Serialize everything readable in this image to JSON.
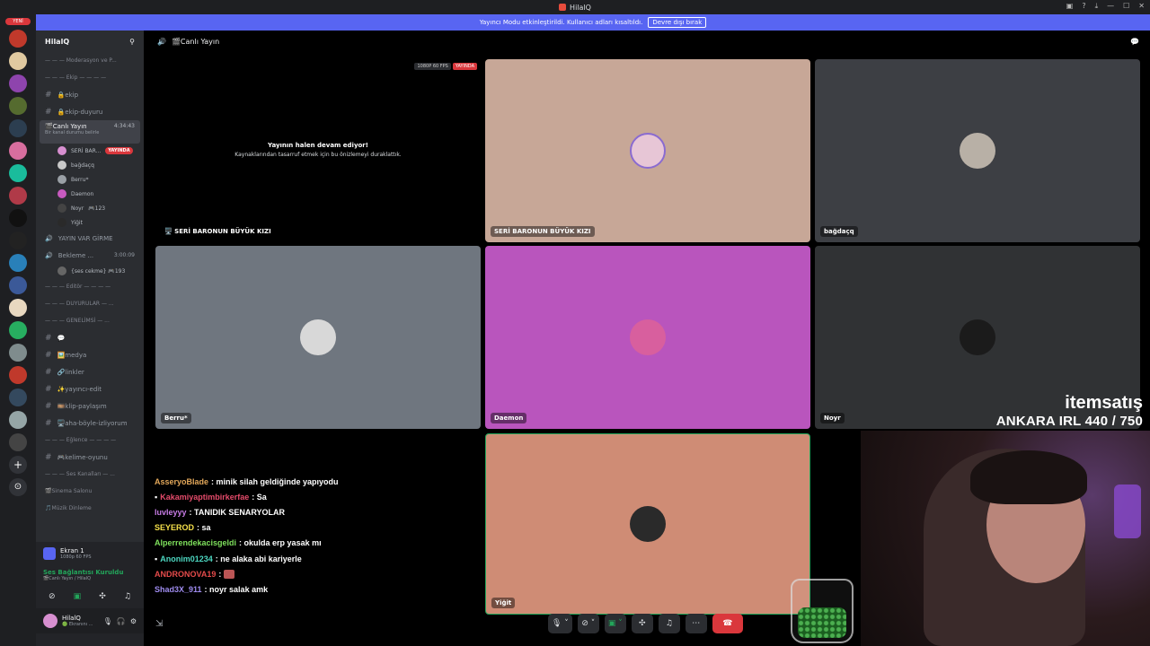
{
  "window": {
    "title": "HilalQ"
  },
  "notice": {
    "text": "Yayıncı Modu etkinleştirildi. Kullanıcı adları kısaltıldı.",
    "button": "Devre dışı bırak"
  },
  "server_badge": "YENİ",
  "sidebar": {
    "server_name": "HilalQ",
    "items": [
      {
        "type": "cat",
        "label": "— — — Moderasyon ve P..."
      },
      {
        "type": "cat",
        "label": "— — — Ekip — — — —"
      },
      {
        "type": "text",
        "label": "🔒ekip"
      },
      {
        "type": "text",
        "label": "🔒ekip-duyuru"
      }
    ],
    "active": {
      "label": "🎬Canlı Yayın",
      "time": "4:34:43",
      "status": "Bir kanal durumu belirle"
    },
    "members": [
      {
        "name": "SERİ BAR...",
        "badge": "YAYINDA",
        "color": "#d78fd0"
      },
      {
        "name": "bağdaçq",
        "badge": "",
        "color": "#c9c9c9"
      },
      {
        "name": "Berru*",
        "badge": "",
        "color": "#9aa0a6"
      },
      {
        "name": "Daemon",
        "badge": "",
        "color": "#c85ac0"
      },
      {
        "name": "Noyr",
        "badge": "🎮123",
        "color": "#444"
      },
      {
        "name": "Yiğit",
        "badge": "",
        "color": "#2a2a2a"
      }
    ],
    "items2": [
      {
        "type": "voice",
        "label": "YAYIN VAR GİRME"
      },
      {
        "type": "voice",
        "label": "Bekleme ...",
        "time": "3:00:09"
      },
      {
        "type": "sub",
        "label": "{ses cekme} 🎮193"
      },
      {
        "type": "cat",
        "label": "— — — Editör — — — —"
      },
      {
        "type": "cat",
        "label": "— — — DUYURULAR — ..."
      },
      {
        "type": "cat",
        "label": "— — — GENELİMSİ — ..."
      },
      {
        "type": "text",
        "label": "💬"
      },
      {
        "type": "text",
        "label": "🖼️medya"
      },
      {
        "type": "text",
        "label": "🔗linkler"
      },
      {
        "type": "text",
        "label": "✨yayıncı-edit"
      },
      {
        "type": "text",
        "label": "🎞️klip-paylaşım"
      },
      {
        "type": "text",
        "label": "🖥️aha-böyle-izliyorum"
      },
      {
        "type": "cat",
        "label": "— — — Eğlence — — — —"
      },
      {
        "type": "text",
        "label": "🎮kelime-oyunu"
      },
      {
        "type": "cat",
        "label": "— — — Ses Kanalları — ..."
      },
      {
        "type": "cat",
        "label": "🎬Sinema Salonu"
      },
      {
        "type": "cat",
        "label": "🎵Müzik Dinleme"
      }
    ],
    "screen": {
      "title": "Ekran 1",
      "sub": "1080p 60 FPS"
    },
    "voice_status": {
      "title": "Ses Bağlantısı Kuruldu",
      "sub": "🎬Canlı Yayın / HilalQ"
    },
    "user": {
      "name": "HilalQ",
      "status": "🟢 Ekranını ..."
    }
  },
  "topbar": {
    "channel": "🎬Canlı Yayın"
  },
  "stream_tile": {
    "badge_quality": "1080P 60 FPS",
    "badge_live": "YAYINDA",
    "message": "Yayının halen devam ediyor!",
    "sub": "Kaynaklarından tasarruf etmek için bu önizlemeyi duraklattık.",
    "label": "🖥️ SERİ BARONUN BÜYÜK KIZI"
  },
  "tiles": [
    {
      "name": "SERİ BARONUN BÜYÜK KIZI",
      "bg": "#c7a797",
      "ava": "#e7c6d6"
    },
    {
      "name": "bağdaçq",
      "bg": "#3d3f44",
      "ava": "#b8b0a6"
    },
    {
      "name": "Berru*",
      "bg": "#6f767f",
      "ava": "#d8d8d8"
    },
    {
      "name": "Daemon",
      "bg": "#b955bd",
      "ava": "#d85f9e"
    },
    {
      "name": "Noyr",
      "bg": "#303234",
      "ava": "#1b1b1b"
    },
    {
      "name": "Yiğit",
      "bg": "#cf8c75",
      "ava": "#2a2a2a"
    }
  ],
  "chat": [
    {
      "user": "AsseryoBlade",
      "color": "#e3a85a",
      "msg": ": minik silah geldiğinde yapıyodu"
    },
    {
      "user": "Kakamiyaptimbirkerfae",
      "color": "#e54b6b",
      "msg": ": Sa"
    },
    {
      "user": "luvleyyy",
      "color": "#c77ce5",
      "msg": ": TANIDIK SENARYOLAR"
    },
    {
      "user": "SEYEROD",
      "color": "#f5e04a",
      "msg": ": sa"
    },
    {
      "user": "Alperrendekacisgeldi",
      "color": "#7ee05c",
      "msg": ": okulda erp yasak mı"
    },
    {
      "user": "Anonim01234",
      "color": "#4cd6c0",
      "msg": ": ne alaka abi kariyerle"
    },
    {
      "user": "ANDRONOVA19",
      "color": "#e54b4b",
      "msg": ":"
    },
    {
      "user": "Shad3X_911",
      "color": "#9f8cf0",
      "msg": ": noyr salak amk"
    }
  ],
  "brand": {
    "name": "itemsatış",
    "counter": "ANKARA IRL 440 / 750"
  }
}
